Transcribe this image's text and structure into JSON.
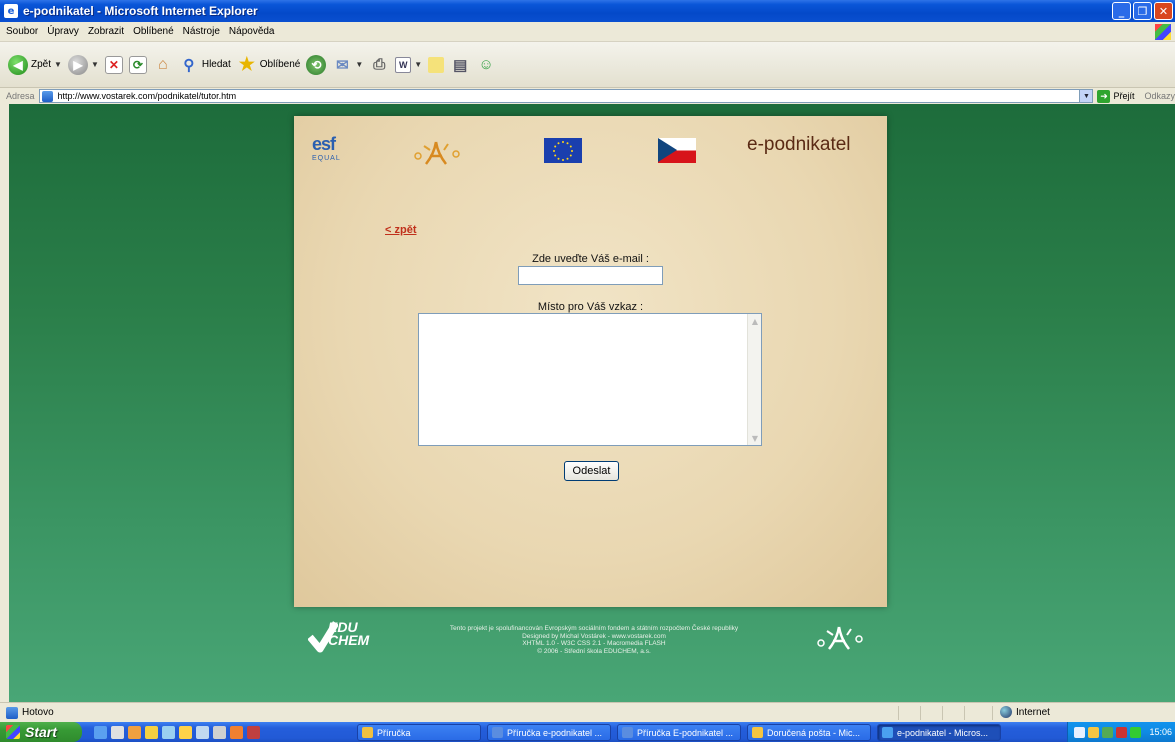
{
  "window": {
    "title": "e-podnikatel - Microsoft Internet Explorer"
  },
  "menu": [
    "Soubor",
    "Úpravy",
    "Zobrazit",
    "Oblíbené",
    "Nástroje",
    "Nápověda"
  ],
  "toolbar": {
    "back_label": "Zpět",
    "search_label": "Hledat",
    "favorites_label": "Oblíbené"
  },
  "address": {
    "label": "Adresa",
    "url": "http://www.vostarek.com/podnikatel/tutor.htm",
    "go_label": "Přejít",
    "links_label": "Odkazy"
  },
  "page": {
    "brand": "e-podnikatel",
    "esf_logo": "esf",
    "equal_logo": "EQUAL",
    "back_link": "< zpět",
    "email_label": "Zde uveďte Váš e-mail :",
    "email_value": "",
    "message_label": "Místo pro Váš vzkaz :",
    "message_value": "",
    "submit_label": "Odeslat",
    "educhem_logo": "EDU\nCHEM",
    "footer_lines": [
      "Tento projekt je spolufinancován Evropským sociálním fondem a státním rozpočtem České republiky",
      "Designed by Michal Vostárek - www.vostarek.com",
      "XHTML 1.0 - W3C CSS 2.1 - Macromedia FLASH",
      "© 2006 - Střední škola EDUCHEM, a.s."
    ]
  },
  "status": {
    "text": "Hotovo",
    "zone": "Internet"
  },
  "taskbar": {
    "start_label": "Start",
    "tasks": [
      {
        "label": "Příručka",
        "icon_color": "#f0c040"
      },
      {
        "label": "Příručka e-podnikatel ...",
        "icon_color": "#5a8de0"
      },
      {
        "label": "Příručka E-podnikatel ...",
        "icon_color": "#5a8de0"
      },
      {
        "label": "Doručená pošta - Mic...",
        "icon_color": "#f5c542"
      },
      {
        "label": "e-podnikatel - Micros...",
        "icon_color": "#4aa0f0"
      }
    ],
    "clock": "15:06"
  },
  "colors": {
    "page_gradient_top": "#1d6c3b",
    "page_gradient_bottom": "#49a676",
    "parchment": "#ecdcb8",
    "brand_text": "#5a2a14",
    "link": "#c0301b"
  }
}
